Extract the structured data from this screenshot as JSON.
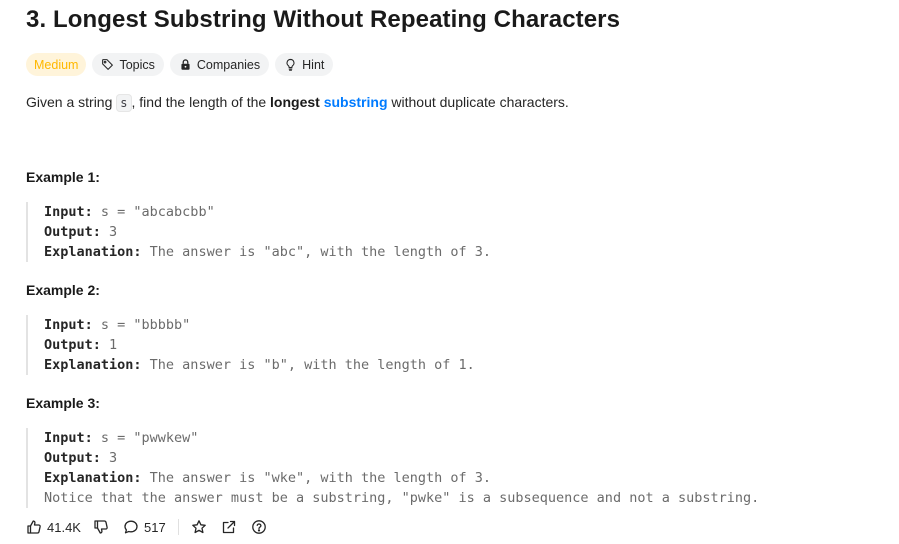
{
  "problem": {
    "title": "3. Longest Substring Without Repeating Characters",
    "tags": {
      "difficulty": "Medium",
      "topics": "Topics",
      "companies": "Companies",
      "hint": "Hint"
    },
    "description": {
      "prefix": "Given a string ",
      "var": "s",
      "middle": ", find the length of the ",
      "bold": "longest",
      "space": " ",
      "link": "substring",
      "suffix": " without duplicate characters."
    },
    "examples": [
      {
        "title": "Example 1:",
        "input_label": "Input: ",
        "input": "s = \"abcabcbb\"",
        "output_label": "Output: ",
        "output": "3",
        "explanation_label": "Explanation: ",
        "explanation": "The answer is \"abc\", with the length of 3.",
        "note": ""
      },
      {
        "title": "Example 2:",
        "input_label": "Input: ",
        "input": "s = \"bbbbb\"",
        "output_label": "Output: ",
        "output": "1",
        "explanation_label": "Explanation: ",
        "explanation": "The answer is \"b\", with the length of 1.",
        "note": ""
      },
      {
        "title": "Example 3:",
        "input_label": "Input: ",
        "input": "s = \"pwwkew\"",
        "output_label": "Output: ",
        "output": "3",
        "explanation_label": "Explanation: ",
        "explanation": "The answer is \"wke\", with the length of 3.",
        "note": "Notice that the answer must be a substring, \"pwke\" is a subsequence and not a substring."
      }
    ]
  },
  "footer": {
    "likes": "41.4K",
    "comments": "517"
  },
  "colors": {
    "difficulty_medium": "#ffb800",
    "link": "#007bff"
  },
  "icons": [
    "tag-icon",
    "lock-icon",
    "lightbulb-icon",
    "thumbs-up-icon",
    "thumbs-down-icon",
    "comment-icon",
    "star-icon",
    "share-icon",
    "help-icon"
  ]
}
